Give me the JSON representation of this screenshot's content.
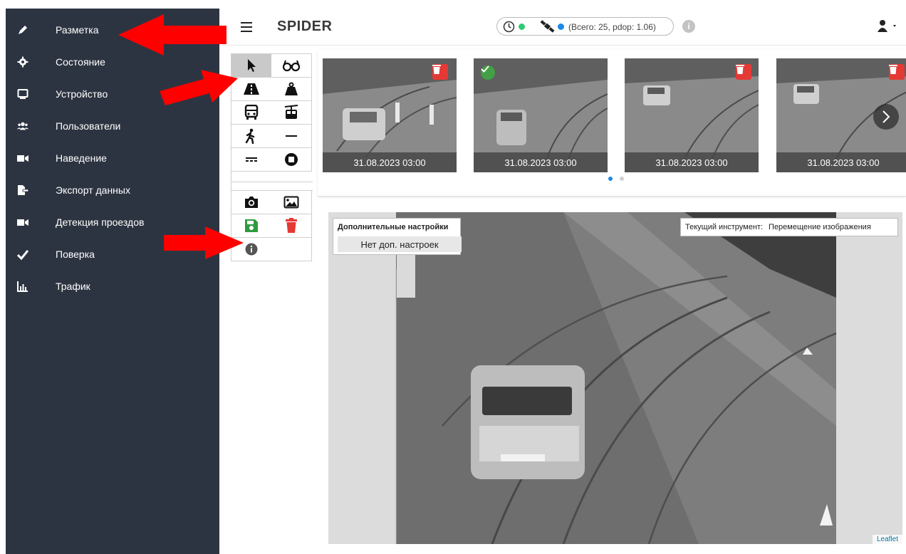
{
  "sidebar": {
    "items": [
      {
        "label": "Разметка",
        "icon": "pen-icon"
      },
      {
        "label": "Состояние",
        "icon": "gear-icon"
      },
      {
        "label": "Устройство",
        "icon": "device-icon"
      },
      {
        "label": "Пользователи",
        "icon": "users-icon"
      },
      {
        "label": "Наведение",
        "icon": "video-camera-icon"
      },
      {
        "label": "Экспорт данных",
        "icon": "file-export-icon"
      },
      {
        "label": "Детекция проездов",
        "icon": "video-camera-icon"
      },
      {
        "label": "Поверка",
        "icon": "check-icon"
      },
      {
        "label": "Трафик",
        "icon": "bar-chart-icon"
      }
    ]
  },
  "header": {
    "title": "SPIDER",
    "status_text": "(Всего: 25, pdop: 1.06)",
    "info_symbol": "i"
  },
  "thumbnails": [
    {
      "caption": "31.08.2023 03:00",
      "badge": "delete"
    },
    {
      "caption": "31.08.2023 03:00",
      "badge": "ok"
    },
    {
      "caption": "31.08.2023 03:00",
      "badge": "delete"
    },
    {
      "caption": "31.08.2023 03:00",
      "badge": "delete"
    }
  ],
  "viewer": {
    "extra_settings_title": "Дополнительные настройки",
    "extra_settings_value": "Нет доп. настроек",
    "current_tool_label": "Текущий инструмент:",
    "current_tool_value": "Перемещение изображения",
    "attribution": "Leaflet"
  },
  "colors": {
    "sidebar_bg": "#2d3441",
    "arrow_red": "#ff0000",
    "status_green": "#2ecc71",
    "status_blue": "#1e88e5",
    "delete_red": "#e53935",
    "ok_green": "#43a047"
  }
}
